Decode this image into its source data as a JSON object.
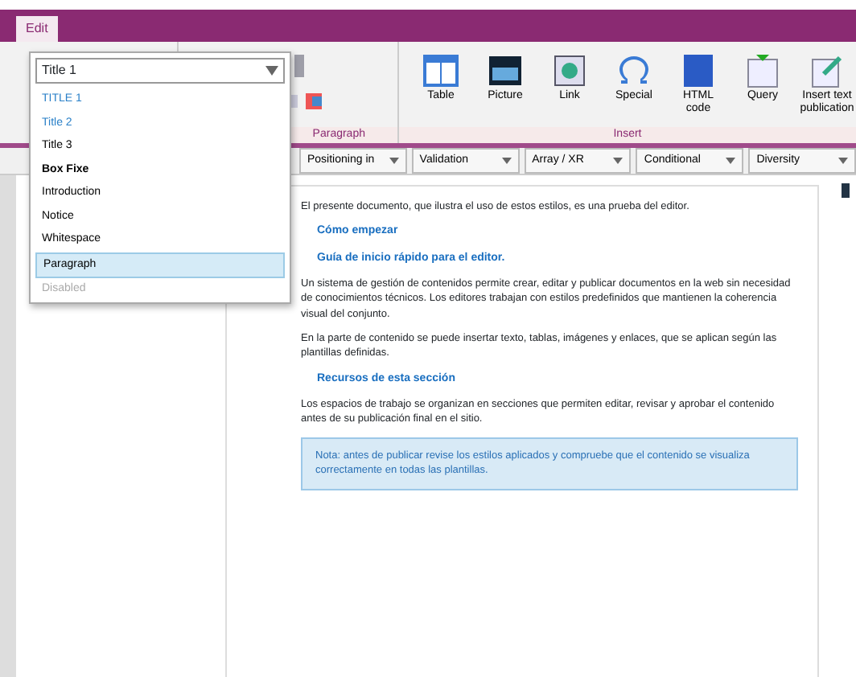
{
  "window": {
    "tab": "Edit"
  },
  "style_select": {
    "value": "Title 1",
    "options": [
      {
        "label": "TITLE 1",
        "kind": "title",
        "selected": false,
        "disabled": false
      },
      {
        "label": "Title 2",
        "kind": "subtitle",
        "selected": false,
        "disabled": false
      },
      {
        "label": "Title 3",
        "kind": "plain",
        "selected": false,
        "disabled": false
      },
      {
        "label": "Box Fixe",
        "kind": "bold",
        "selected": false,
        "disabled": false
      },
      {
        "label": "Introduction",
        "kind": "plain",
        "selected": false,
        "disabled": false
      },
      {
        "label": "Notice",
        "kind": "plain",
        "selected": false,
        "disabled": false
      },
      {
        "label": "Whitespace",
        "kind": "plain",
        "selected": false,
        "disabled": false
      },
      {
        "label": "Paragraph",
        "kind": "plain",
        "selected": true,
        "disabled": false
      },
      {
        "label": "Disabled",
        "kind": "plain",
        "selected": false,
        "disabled": true
      }
    ]
  },
  "ribbon": {
    "groups": [
      {
        "label": "Paragraph"
      },
      {
        "label": "Insert"
      }
    ],
    "insert_buttons": [
      {
        "label": "Table"
      },
      {
        "label": "Picture"
      },
      {
        "label": "Link"
      },
      {
        "label": "Special"
      },
      {
        "label": "HTML code"
      },
      {
        "label": "Query"
      },
      {
        "label": "Insert text publication"
      }
    ]
  },
  "toolbar": [
    "Positioning in",
    "Validation",
    "Array / XR",
    "Conditional",
    "Diversity"
  ],
  "document": [
    {
      "kind": "para",
      "text": "El presente documento, que ilustra el uso de estos estilos, es una prueba del editor."
    },
    {
      "kind": "heading",
      "text": "Cómo empezar"
    },
    {
      "kind": "heading",
      "text": "Guía de inicio rápido para el editor."
    },
    {
      "kind": "para",
      "text": "Un sistema de gestión de contenidos permite crear, editar y publicar documentos en la web sin necesidad de conocimientos técnicos. Los editores trabajan con estilos predefinidos que mantienen la coherencia visual del conjunto."
    },
    {
      "kind": "para",
      "text": "En la parte de contenido se puede insertar texto, tablas, imágenes y enlaces, que se aplican según las plantillas definidas."
    },
    {
      "kind": "subheading",
      "text": "Recursos de esta sección"
    },
    {
      "kind": "para",
      "text": "Los espacios de trabajo se organizan en secciones que permiten editar, revisar y aprobar el contenido antes de su publicación final en el sitio."
    },
    {
      "kind": "notice",
      "text": "Nota: antes de publicar revise los estilos aplicados y compruebe que el contenido se visualiza correctamente en todas las plantillas."
    }
  ]
}
